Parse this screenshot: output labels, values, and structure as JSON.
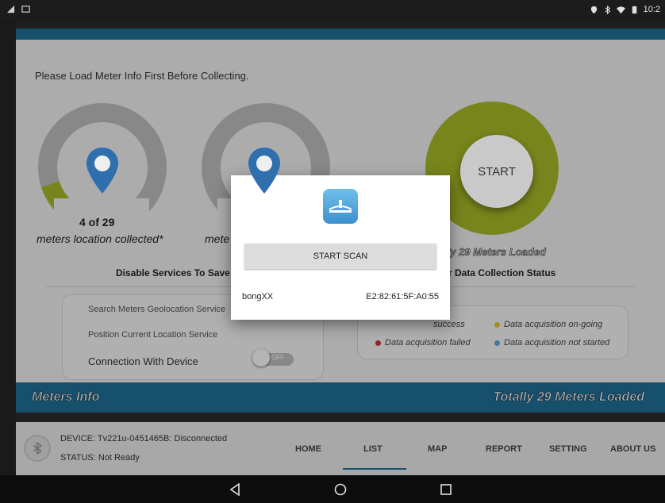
{
  "status_bar": {
    "time": "10:2",
    "icons": [
      "signal-icon",
      "image-icon",
      "location-icon",
      "bluetooth-icon",
      "wifi-icon",
      "battery-icon"
    ]
  },
  "main": {
    "instruction": "Please Load Meter Info First Before Collecting.",
    "location_count": "4 of 29",
    "location_label": "meters location collected*",
    "second_label": "mete",
    "start_label": "START",
    "loaded_label": "lly 29 Meters Loaded",
    "services_title": "Disable Services To Save",
    "status_title": "r Data Collection Status",
    "services": {
      "search_geo": "Search Meters Geolocation Service",
      "position": "Position Current Location Service",
      "connection": "Connection With Device",
      "toggle_label": "OFF"
    },
    "legend": {
      "success": "success",
      "ongoing": "Data acquisition on-going",
      "failed": "Data acquisition failed",
      "not_started": "Data acquisition not started",
      "colors": {
        "success": "#4caf50",
        "ongoing": "#e6c23a",
        "failed": "#d32f2f",
        "not_started": "#5aaad8"
      }
    }
  },
  "meters_bar": {
    "left": "Meters Info",
    "right": "Totally 29 Meters Loaded"
  },
  "bottom": {
    "device": "DEVICE:  Tv221u-0451465B: Disconnected",
    "status": "STATUS: Not Ready",
    "nav": [
      "HOME",
      "LIST",
      "MAP",
      "REPORT",
      "SETTING",
      "ABOUT US"
    ],
    "active_nav": "LIST"
  },
  "dialog": {
    "scan_button": "START SCAN",
    "device_name": "bongXX",
    "device_mac": "E2:82:61:5F:A0:55"
  },
  "colors": {
    "accent": "#1f6f97",
    "gauge_green": "#a7b927",
    "pin_blue": "#2f6fae"
  }
}
